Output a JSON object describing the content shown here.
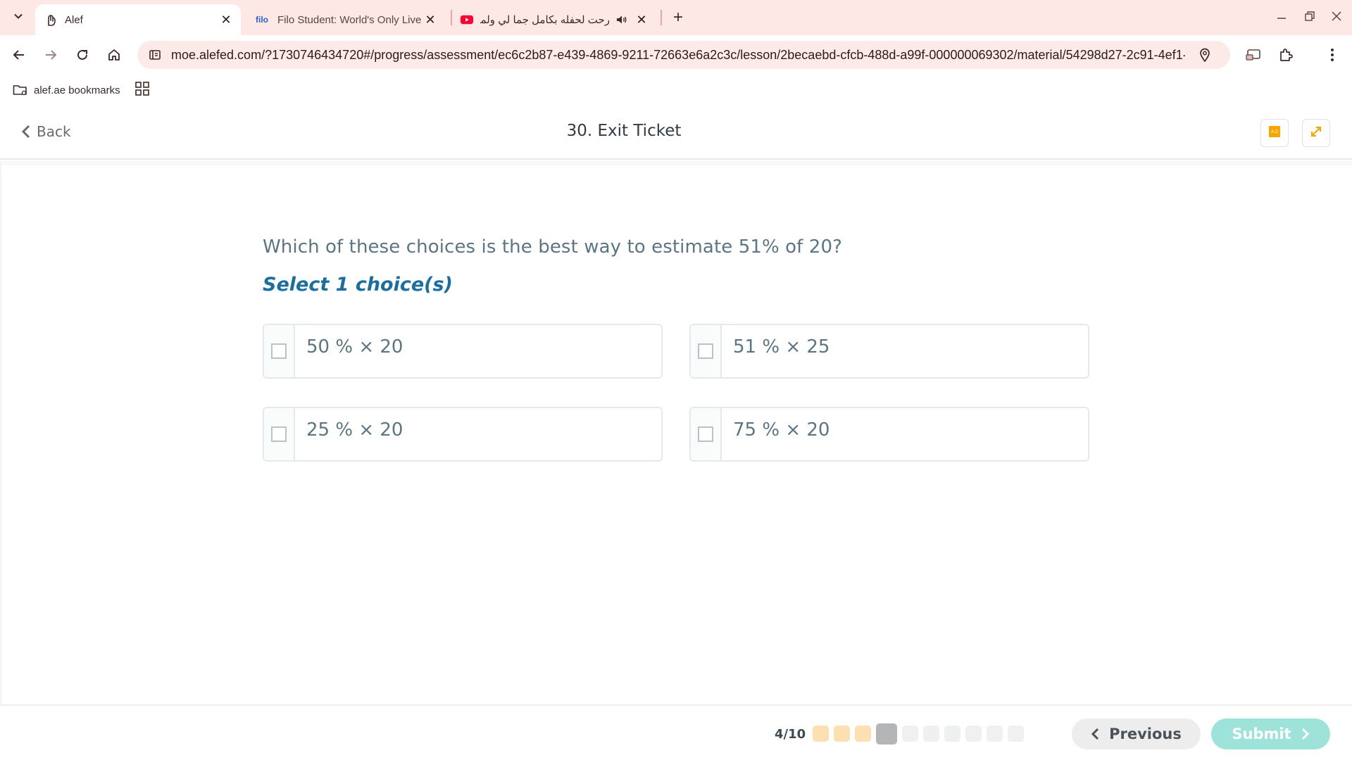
{
  "browser": {
    "tabs": [
      {
        "title": "Alef",
        "favicon": "alef-hand-icon",
        "active": true
      },
      {
        "title": "Filo Student: World's Only Live I",
        "favicon_text": "filo",
        "active": false
      },
      {
        "title": "رحت لحفله بكامل جما لي ولماذ",
        "favicon": "youtube-icon",
        "active": false,
        "audio": true
      }
    ],
    "new_tab_label": "+",
    "url": "moe.alefed.com/?1730746434720#/progress/assessment/ec6c2b87-e439-4869-9211-72663e6a2c3c/lesson/2becaebd-cfcb-488d-a99f-000000069302/material/54298d27-2c91-4ef1-...",
    "bookmarks": [
      {
        "label": "alef.ae bookmarks"
      }
    ],
    "accent": "#fde8e6"
  },
  "header": {
    "back_label": "Back",
    "title": "30. Exit Ticket"
  },
  "question": {
    "text": "Which of these choices is the best way to estimate 51% of 20?",
    "select_note": "Select 1 choice(s)",
    "choices": [
      {
        "label": "50 % × 20",
        "checked": false
      },
      {
        "label": "51 % × 25",
        "checked": false
      },
      {
        "label": "25 % × 20",
        "checked": false
      },
      {
        "label": "75 % × 20",
        "checked": false
      }
    ]
  },
  "footer": {
    "progress_label": "4/10",
    "current": 4,
    "total": 10,
    "previous_label": "Previous",
    "submit_label": "Submit",
    "colors": {
      "done": "#fde0b1",
      "current": "#b3b5b7",
      "pending": "#eef0f1",
      "submit": "#9ee3d9"
    }
  }
}
